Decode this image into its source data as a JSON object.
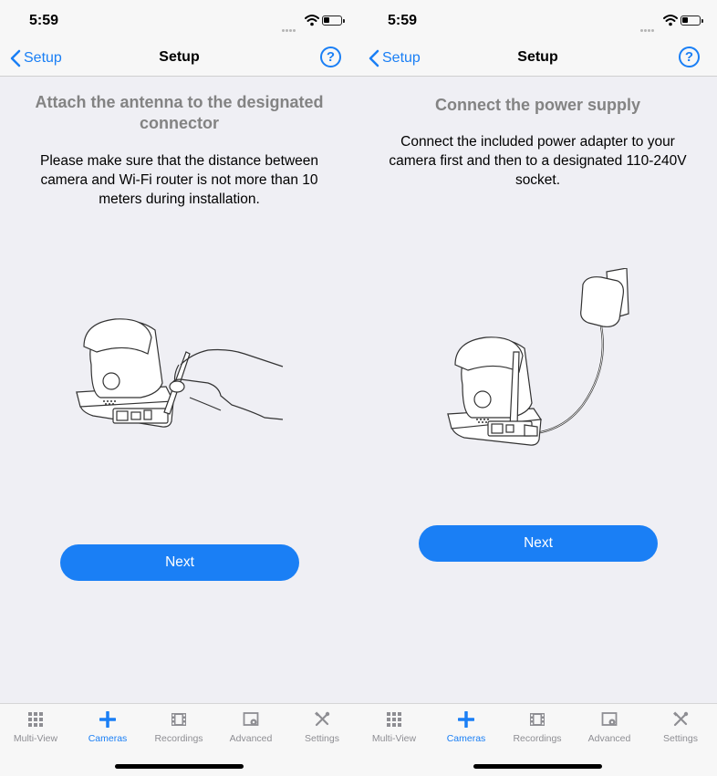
{
  "status_bar": {
    "time": "5:59"
  },
  "navigation": {
    "back_label": "Setup",
    "title": "Setup",
    "help_label": "?"
  },
  "steps": [
    {
      "title": "Attach the antenna to the designated connector",
      "description": "Please make sure that the distance between camera and Wi-Fi router is not more than 10 meters during installation.",
      "next_label": "Next"
    },
    {
      "title": "Connect the power supply",
      "description": "Connect the included power adapter to your camera first and then to a designated 110-240V socket.",
      "next_label": "Next"
    }
  ],
  "tab_bar": {
    "tabs": [
      {
        "label": "Multi-View",
        "icon": "grid-icon",
        "active": false
      },
      {
        "label": "Cameras",
        "icon": "plus-icon",
        "active": true
      },
      {
        "label": "Recordings",
        "icon": "film-icon",
        "active": false
      },
      {
        "label": "Advanced",
        "icon": "advanced-icon",
        "active": false
      },
      {
        "label": "Settings",
        "icon": "tools-icon",
        "active": false
      }
    ]
  },
  "colors": {
    "accent": "#1a7ff5",
    "background": "#efeff4",
    "title_gray": "#838383",
    "tab_gray": "#8e8e93"
  }
}
